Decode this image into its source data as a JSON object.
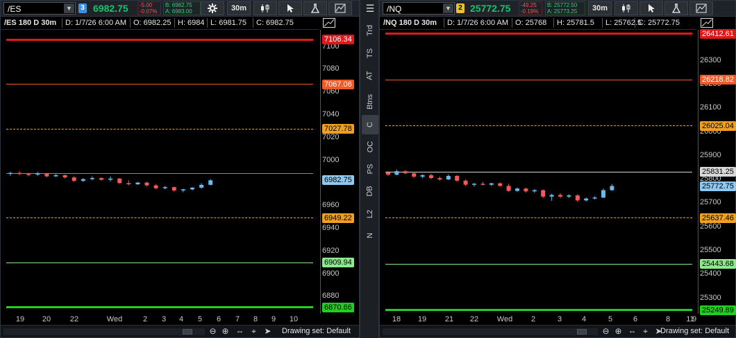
{
  "left": {
    "symbol": "/ES",
    "link_number": "3",
    "link_color": "#3d8fe0",
    "last": "6982.75",
    "net_change": "-5.00",
    "pct_change": "-0.07%",
    "bid": "B: 6982.75",
    "ask": "A: 6983.00",
    "timeframe": "30m",
    "info": {
      "title": "/ES 180 D 30m",
      "date": "D: 1/7/26 6:00 AM",
      "open": "O: 6982.25",
      "high": "H: 6984",
      "low": "L: 6981.75",
      "close": "C: 6982.75"
    },
    "price_range": [
      6865,
      7115
    ],
    "ticks": [
      "7100",
      "7080",
      "7060",
      "7040",
      "7020",
      "7000",
      "6980",
      "6960",
      "6940",
      "6920",
      "6900",
      "6880"
    ],
    "levels": [
      {
        "label": "7106.34",
        "value": 7106.34,
        "color": "#e01818",
        "style": "thick",
        "tag_text": "#ffffff"
      },
      {
        "label": "7067.06",
        "value": 7067.06,
        "color": "#f05a28",
        "style": "thin",
        "tag_text": "#ffffff"
      },
      {
        "label": "7027.78",
        "value": 7027.78,
        "color": "#f0a020",
        "style": "dashed",
        "tag_text": "#000000"
      },
      {
        "label": "6982.75",
        "value": 6982.75,
        "color": "#8fc8f0",
        "style": "none",
        "tag_text": "#000000"
      },
      {
        "label": "6949.22",
        "value": 6949.22,
        "color": "#f0a020",
        "style": "dashed",
        "tag_text": "#000000"
      },
      {
        "label": "6909.94",
        "value": 6909.94,
        "color": "#8ee88e",
        "style": "thin",
        "tag_text": "#000000"
      },
      {
        "label": "6870.66",
        "value": 6870.66,
        "color": "#20d020",
        "style": "thick",
        "tag_text": "#000000"
      }
    ],
    "reference_line": 6988.5,
    "candles": [
      [
        6988.5,
        6990.0,
        6986.5,
        6989.0
      ],
      [
        6989.0,
        6990.5,
        6987.0,
        6988.0
      ],
      [
        6988.0,
        6989.0,
        6986.0,
        6987.5
      ],
      [
        6987.5,
        6990.0,
        6986.5,
        6988.5
      ],
      [
        6988.5,
        6989.0,
        6985.0,
        6986.0
      ],
      [
        6986.0,
        6988.0,
        6985.5,
        6987.0
      ],
      [
        6987.0,
        6987.5,
        6984.0,
        6985.0
      ],
      [
        6985.0,
        6986.0,
        6981.0,
        6982.0
      ],
      [
        6982.0,
        6984.5,
        6981.0,
        6983.5
      ],
      [
        6983.5,
        6986.0,
        6982.5,
        6984.5
      ],
      [
        6984.5,
        6985.0,
        6982.0,
        6983.0
      ],
      [
        6983.0,
        6986.0,
        6981.5,
        6984.0
      ],
      [
        6984.0,
        6984.5,
        6979.5,
        6980.0
      ],
      [
        6980.0,
        6982.5,
        6978.0,
        6979.0
      ],
      [
        6979.0,
        6981.0,
        6978.5,
        6980.5
      ],
      [
        6980.5,
        6981.0,
        6977.0,
        6978.0
      ],
      [
        6978.0,
        6979.0,
        6974.5,
        6975.5
      ],
      [
        6975.5,
        6977.5,
        6974.5,
        6976.5
      ],
      [
        6976.5,
        6977.0,
        6972.5,
        6973.5
      ],
      [
        6973.5,
        6975.0,
        6972.0,
        6974.5
      ],
      [
        6974.5,
        6976.5,
        6973.5,
        6976.0
      ],
      [
        6976.0,
        6980.0,
        6975.0,
        6978.5
      ],
      [
        6978.5,
        6983.5,
        6978.0,
        6982.5
      ]
    ],
    "time_labels": [
      "19",
      "20",
      "22",
      "Wed",
      "2",
      "3",
      "4",
      "5",
      "6",
      "7",
      "8",
      "9",
      "10"
    ],
    "drawing_set": "Drawing set: Default"
  },
  "right": {
    "symbol": "/NQ",
    "link_number": "2",
    "link_color": "#e8c030",
    "last": "25772.75",
    "net_change": "-49.25",
    "pct_change": "-0.19%",
    "bid": "B: 25772.50",
    "ask": "A: 25773.25",
    "timeframe": "30m",
    "info": {
      "title": "/NQ 180 D 30m",
      "date": "D: 1/7/26 6:00 AM",
      "open": "O: 25768",
      "high": "H: 25781.5",
      "low": "L: 25762.5",
      "close": "C: 25772.75"
    },
    "price_range": [
      25235,
      26430
    ],
    "ticks": [
      "26300",
      "26200",
      "26100",
      "26000",
      "25900",
      "25800",
      "25700",
      "25600",
      "25500",
      "25400",
      "25300"
    ],
    "levels": [
      {
        "label": "26412.61",
        "value": 26412.61,
        "color": "#e01818",
        "style": "thick",
        "tag_text": "#ffffff"
      },
      {
        "label": "26218.82",
        "value": 26218.82,
        "color": "#f05a28",
        "style": "thin",
        "tag_text": "#ffffff"
      },
      {
        "label": "26025.04",
        "value": 26025.04,
        "color": "#f0a020",
        "style": "dashed",
        "tag_text": "#000000"
      },
      {
        "label": "25831.25",
        "value": 25831.25,
        "color": "#d8d8d8",
        "style": "thin",
        "tag_text": "#000000"
      },
      {
        "label": "25772.75",
        "value": 25772.75,
        "color": "#8fc8f0",
        "style": "none",
        "tag_text": "#000000"
      },
      {
        "label": "25637.46",
        "value": 25637.46,
        "color": "#f0a020",
        "style": "dashed",
        "tag_text": "#000000"
      },
      {
        "label": "25443.68",
        "value": 25443.68,
        "color": "#8ee88e",
        "style": "thin",
        "tag_text": "#000000"
      },
      {
        "label": "25249.89",
        "value": 25249.89,
        "color": "#20d020",
        "style": "thick",
        "tag_text": "#000000"
      }
    ],
    "reference_line": null,
    "candles": [
      [
        25830,
        25836,
        25815,
        25820
      ],
      [
        25820,
        25842,
        25818,
        25835
      ],
      [
        25835,
        25840,
        25822,
        25826
      ],
      [
        25826,
        25830,
        25806,
        25812
      ],
      [
        25812,
        25822,
        25805,
        25818
      ],
      [
        25818,
        25825,
        25802,
        25806
      ],
      [
        25806,
        25812,
        25795,
        25800
      ],
      [
        25800,
        25822,
        25798,
        25815
      ],
      [
        25815,
        25818,
        25790,
        25795
      ],
      [
        25795,
        25800,
        25772,
        25778
      ],
      [
        25778,
        25785,
        25770,
        25782
      ],
      [
        25782,
        25790,
        25775,
        25778
      ],
      [
        25778,
        25786,
        25772,
        25784
      ],
      [
        25784,
        25788,
        25770,
        25773
      ],
      [
        25773,
        25782,
        25748,
        25752
      ],
      [
        25752,
        25766,
        25748,
        25762
      ],
      [
        25762,
        25765,
        25745,
        25750
      ],
      [
        25750,
        25760,
        25744,
        25755
      ],
      [
        25755,
        25758,
        25722,
        25728
      ],
      [
        25728,
        25740,
        25710,
        25735
      ],
      [
        25735,
        25742,
        25722,
        25728
      ],
      [
        25728,
        25738,
        25722,
        25733
      ],
      [
        25733,
        25738,
        25706,
        25712
      ],
      [
        25712,
        25724,
        25707,
        25720
      ],
      [
        25720,
        25730,
        25716,
        25724
      ],
      [
        25724,
        25762,
        25722,
        25755
      ],
      [
        25755,
        25781,
        25752,
        25772.75
      ]
    ],
    "time_labels": [
      "18",
      "19",
      "21",
      "22",
      "Wed",
      "2",
      "3",
      "4",
      "5",
      "6",
      "8",
      "9",
      "11"
    ],
    "drawing_set": "Drawing set: Default"
  },
  "side_tabs": [
    "Trd",
    "TS",
    "AT",
    "Btns",
    "C",
    "OC",
    "PS",
    "DB",
    "L2",
    "N"
  ],
  "active_side_tab": "C",
  "colors": {
    "up_candle": "#6ab8f0",
    "down_candle": "#f05a5a",
    "background": "#000000",
    "positive": "#19c36b",
    "negative": "#ff4d4d"
  },
  "icons": [
    "settings-gear-icon",
    "candlestick-style-icon",
    "cursor-icon",
    "studies-flask-icon",
    "drawing-tools-icon",
    "menu-icon",
    "zoom-out-icon",
    "zoom-in-icon",
    "pan-arrows-icon",
    "crosshair-icon",
    "pointer-icon"
  ]
}
